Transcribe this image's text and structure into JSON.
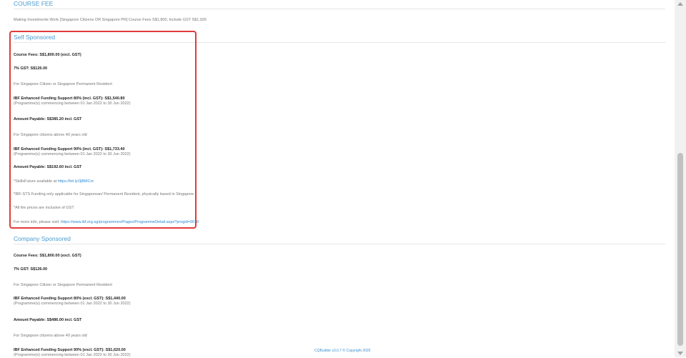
{
  "course_fee": {
    "title": "COURSE FEE",
    "description": "Making Investments Work [Singapore Citizens OR Singapore PR] Course Fees S$1,800, Include GST S$1,926"
  },
  "self_sponsored": {
    "title": "Self Sponsored",
    "fees": "Course Fees: S$1,800.00 (excl. GST)",
    "gst": "7% GST: S$126.00",
    "citizen_note": "For Singapore Citizen or Singapore Permanent Resident",
    "ibf80": "IBF Enhanced Funding Support 80% (incl. GST): S$1,540.80",
    "ibf80_period": "(Programme(s) commencing between 01 Jan 2022 to 30 Jun 2022)",
    "payable1": "Amount Payable: S$385.20 incl. GST",
    "above40_note": "For Singapore citizens above 40 years old",
    "ibf90": "IBF Enhanced Funding Support 90% (incl. GST): S$1,733.40",
    "ibf90_period": "(Programme(s) commencing between 01 Jan 2022 to 30 Jun 2022)",
    "payable2": "Amount Payable: S$192.60 incl. GST",
    "skills_prefix": "*SkillsFuture available at ",
    "skills_link": "https://bit.ly/3jBMCxr",
    "ibf_sts_note": "*IBF-STS Funding only applicable for Singaporean/ Permanent Resident, physically based in Singapore",
    "gst_note": "*All the prices are inclusive of GST",
    "more_prefix": "For more info, please visit: ",
    "more_link": "https://www.ibf.org.sg/programmes/Pages/ProgrammeDetail.aspx?progid=9018"
  },
  "company_sponsored": {
    "title": "Company Sponsored",
    "fees": "Course Fees: S$1,800.00 (excl. GST)",
    "gst": "7% GST: S$126.00",
    "citizen_note": "For Singapore Citizen or Singapore Permanent Resident",
    "ibf80": "IBF Enhanced Funding Support 80% (excl. GST): S$1,440.00",
    "ibf80_period": "(Programme(s) commencing between 01 Jan 2022 to 30 Jun 2022)",
    "payable1": "Amount Payable: S$486.00 incl. GST",
    "above40_note": "For Singapore citizens above 40 years old",
    "ibf90": "IBF Enhanced Funding Support 90% (excl. GST): S$1,620.00",
    "ibf90_period": "(Programme(s) commencing between 01 Jan 2022 to 30 Jun 2022)"
  },
  "footer": {
    "text": "CQBuilder v3.0.7 © Copyright 2020"
  },
  "colors": {
    "section_title": "#4a9bd1",
    "link": "#2a8ad4",
    "highlight_border": "#e03a3a"
  }
}
